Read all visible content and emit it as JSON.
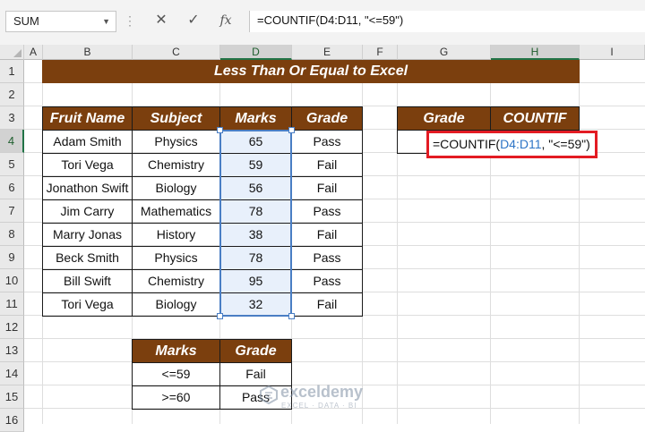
{
  "formula_bar": {
    "name_box": "SUM",
    "cancel_icon": "✕",
    "enter_icon": "✓",
    "fx_icon": "fx",
    "formula": "=COUNTIF(D4:D11, \"<=59\")"
  },
  "columns": [
    "A",
    "B",
    "C",
    "D",
    "E",
    "F",
    "G",
    "H",
    "I"
  ],
  "rows": [
    "1",
    "2",
    "3",
    "4",
    "5",
    "6",
    "7",
    "8",
    "9",
    "10",
    "11",
    "12",
    "13",
    "14",
    "15",
    "16"
  ],
  "title": "Less Than Or Equal to Excel",
  "main_table": {
    "headers": [
      "Fruit Name",
      "Subject",
      "Marks",
      "Grade"
    ],
    "rows": [
      [
        "Adam Smith",
        "Physics",
        "65",
        "Pass"
      ],
      [
        "Tori Vega",
        "Chemistry",
        "59",
        "Fail"
      ],
      [
        "Jonathon Swift",
        "Biology",
        "56",
        "Fail"
      ],
      [
        "Jim Carry",
        "Mathematics",
        "78",
        "Pass"
      ],
      [
        "Marry Jonas",
        "History",
        "38",
        "Fail"
      ],
      [
        "Beck Smith",
        "Physics",
        "78",
        "Pass"
      ],
      [
        "Bill Swift",
        "Chemistry",
        "95",
        "Pass"
      ],
      [
        "Tori Vega",
        "Biology",
        "32",
        "Fail"
      ]
    ]
  },
  "countif_table": {
    "headers": [
      "Grade",
      "COUNTIF"
    ],
    "edit_prefix": "=COUNTIF(",
    "edit_ref": "D4:D11",
    "edit_suffix": ", \"<=59\")"
  },
  "criteria_table": {
    "headers": [
      "Marks",
      "Grade"
    ],
    "rows": [
      [
        "<=59",
        "Fail"
      ],
      [
        ">=60",
        "Pass"
      ]
    ]
  },
  "watermark": {
    "name": "exceldemy",
    "tagline": "EXCEL · DATA · BI"
  },
  "colors": {
    "header_fill": "#7b3f0e",
    "selection": "#4a7ec4",
    "highlight_box": "#e31b23",
    "reference": "#2e75c6"
  }
}
